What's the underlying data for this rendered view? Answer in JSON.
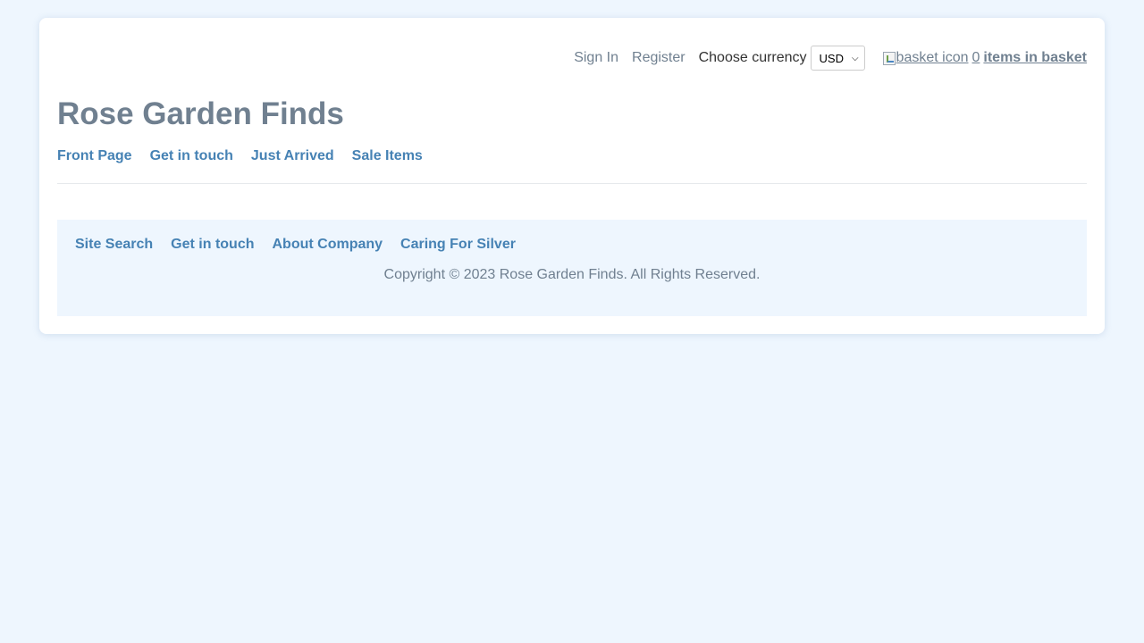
{
  "header": {
    "sign_in": "Sign In",
    "register": "Register",
    "currency_label": "Choose currency",
    "currency_value": "USD",
    "basket_alt": "basket icon",
    "basket_count": "0",
    "basket_items_label": "items in basket"
  },
  "site_title": "Rose Garden Finds",
  "main_nav": [
    {
      "label": "Front Page"
    },
    {
      "label": "Get in touch"
    },
    {
      "label": "Just Arrived"
    },
    {
      "label": "Sale Items"
    }
  ],
  "footer": {
    "nav": [
      {
        "label": "Site Search"
      },
      {
        "label": "Get in touch"
      },
      {
        "label": "About Company"
      },
      {
        "label": "Caring For Silver"
      }
    ],
    "copyright": "Copyright © 2023 Rose Garden Finds. All Rights Reserved."
  },
  "colors": {
    "page_background": "#eef6fe",
    "title_color": "#708090",
    "nav_link_color": "#4682b4"
  }
}
